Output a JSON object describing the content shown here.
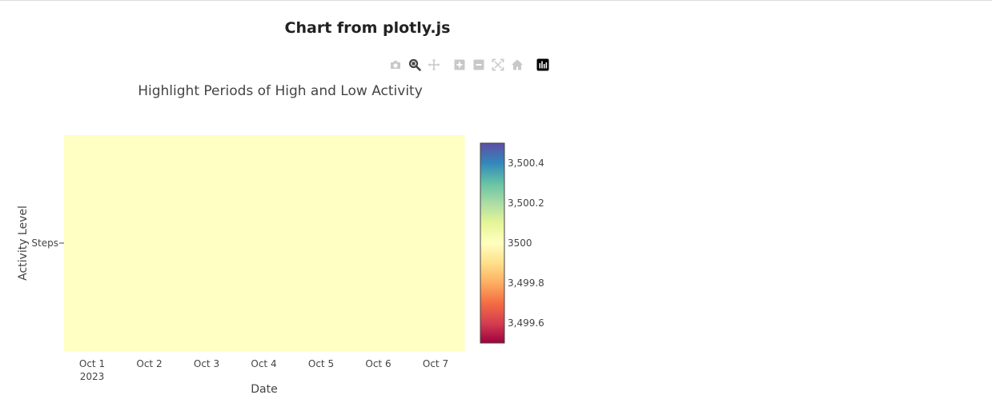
{
  "page": {
    "title": "Chart from plotly.js"
  },
  "modebar": {
    "buttons": [
      {
        "name": "camera-icon",
        "active": false
      },
      {
        "name": "zoom-icon",
        "active": true
      },
      {
        "name": "pan-icon",
        "active": false
      },
      {
        "name": "zoom-in-icon",
        "active": false
      },
      {
        "name": "zoom-out-icon",
        "active": false
      },
      {
        "name": "autoscale-icon",
        "active": false
      },
      {
        "name": "home-icon",
        "active": false
      },
      {
        "name": "plotly-logo-icon",
        "active": false
      }
    ],
    "icon_color": "#c8c8c8",
    "active_color": "#444444"
  },
  "chart_data": {
    "type": "heatmap",
    "title": "Highlight Periods of High and Low Activity",
    "xlabel": "Date",
    "ylabel": "Activity Level",
    "x": [
      "2023-10-01",
      "2023-10-02",
      "2023-10-03",
      "2023-10-04",
      "2023-10-05",
      "2023-10-06",
      "2023-10-07"
    ],
    "x_tick_labels": [
      "Oct 1",
      "Oct 2",
      "Oct 3",
      "Oct 4",
      "Oct 5",
      "Oct 6",
      "Oct 7"
    ],
    "x_tick_sublabel": "2023",
    "y": [
      "Steps"
    ],
    "z": [
      [
        3500,
        3500,
        3500,
        3500,
        3500,
        3500,
        3500
      ]
    ],
    "colorscale": "Spectral",
    "colorbar": {
      "range": [
        3499.5,
        3500.5
      ],
      "ticks": [
        3499.6,
        3499.8,
        3500,
        3500.2,
        3500.4
      ],
      "tick_labels": [
        "3,499.6",
        "3,499.8",
        "3500",
        "3,500.2",
        "3,500.4"
      ]
    },
    "cell_color": "#ffffc4"
  }
}
